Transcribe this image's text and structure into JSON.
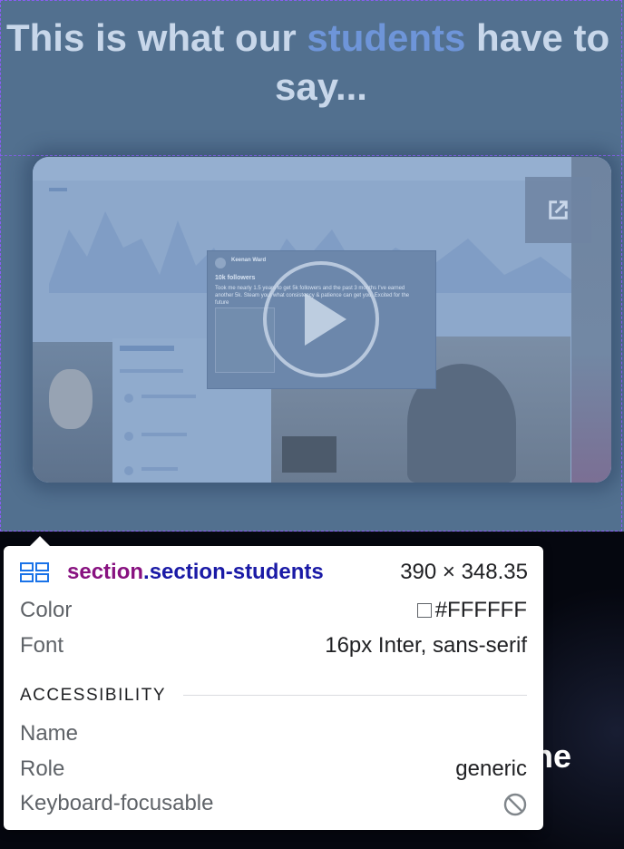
{
  "section": {
    "heading_line1_prefix": "This is what our ",
    "heading_accent": "students",
    "heading_line1_suffix": " have to",
    "heading_line2": "say...",
    "accent_color": "#6e95d9",
    "background_color": "#52708f"
  },
  "video": {
    "play_icon": "play-icon",
    "external_icon": "open-in-new-icon",
    "tweet": {
      "author": "Keenan Ward",
      "title": "10k followers",
      "body": "Took me nearly 1.5 years to get 5k followers and the past 3 months I've earned another 5k. Steam your what consistency & patience can get you. Excited for the future"
    }
  },
  "below": {
    "heading_fragment": "ne"
  },
  "inspector": {
    "tag": "section",
    "class_selector": ".section-students",
    "dimensions": "390 × 348.35",
    "rows": [
      {
        "label": "Color",
        "value": "#FFFFFF"
      },
      {
        "label": "Font",
        "value": "16px Inter, sans-serif"
      }
    ],
    "accessibility_title": "ACCESSIBILITY",
    "accessibility_rows": [
      {
        "label": "Name",
        "value": ""
      },
      {
        "label": "Role",
        "value": "generic"
      },
      {
        "label": "Keyboard-focusable",
        "value": ""
      }
    ],
    "grid_icon": "grid-layout-icon",
    "no_focus_icon": "not-allowed-icon",
    "selector_tag_color": "#881280",
    "selector_class_color": "#1a1aa6"
  }
}
